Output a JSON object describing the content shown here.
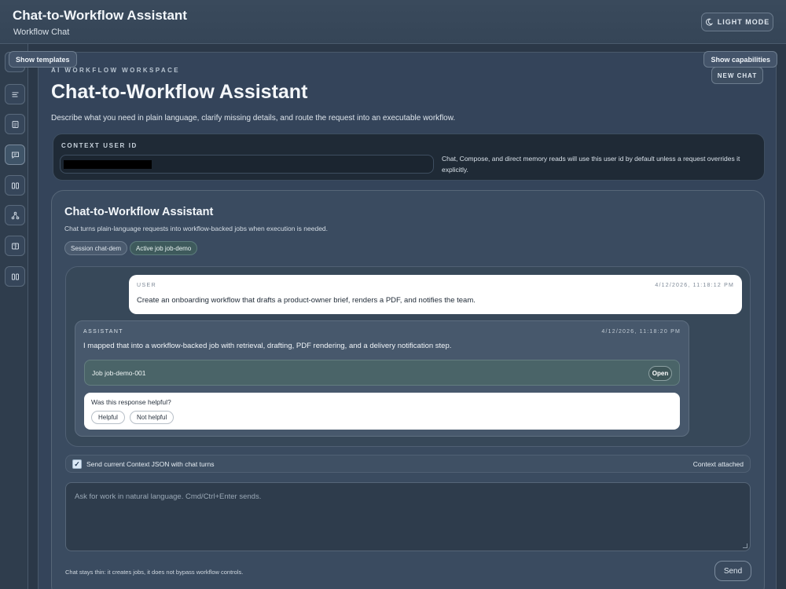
{
  "header": {
    "title": "Chat-to-Workflow Assistant",
    "subtitle": "Workflow Chat",
    "light_mode_label": "LIGHT MODE",
    "light_mode_icon": "moon-icon"
  },
  "floating": {
    "show_templates": "Show templates",
    "show_capabilities": "Show capabilities"
  },
  "rail": {
    "icons": [
      "home-icon",
      "menu-icon",
      "document-icon",
      "chat-icon",
      "columns-icon",
      "workflow-icon",
      "book-icon",
      "columns-icon"
    ],
    "active_index": 3
  },
  "workspace": {
    "kicker": "AI WORKFLOW WORKSPACE",
    "title": "Chat-to-Workflow Assistant",
    "description": "Describe what you need in plain language, clarify missing details, and route the request into an executable workflow.",
    "new_chat": "NEW CHAT"
  },
  "context": {
    "label": "CONTEXT USER ID",
    "note": "Chat, Compose, and direct memory reads will use this user id by default unless a request overrides it explicitly."
  },
  "chat": {
    "title": "Chat-to-Workflow Assistant",
    "subtitle": "Chat turns plain-language requests into workflow-backed jobs when execution is needed.",
    "session_pill": "Session chat-dem",
    "job_pill": "Active job job-demo",
    "messages": {
      "user": {
        "role": "USER",
        "time": "4/12/2026, 11:18:12 PM",
        "text": "Create an onboarding workflow that drafts a product-owner brief, renders a PDF, and notifies the team."
      },
      "assistant": {
        "role": "ASSISTANT",
        "time": "4/12/2026, 11:18:20 PM",
        "text": "I mapped that into a workflow-backed job with retrieval, drafting, PDF rendering, and a delivery notification step.",
        "job_label": "Job job-demo-001",
        "open_label": "Open",
        "feedback_question": "Was this response helpful?",
        "helpful": "Helpful",
        "not_helpful": "Not helpful"
      }
    },
    "context_toggle_label": "Send current Context JSON with chat turns",
    "context_toggle_checked": true,
    "context_attached": "Context attached",
    "composer_placeholder": "Ask for work in natural language. Cmd/Ctrl+Enter sends.",
    "footnote": "Chat stays thin: it creates jobs, it does not bypass workflow controls.",
    "send_label": "Send"
  }
}
